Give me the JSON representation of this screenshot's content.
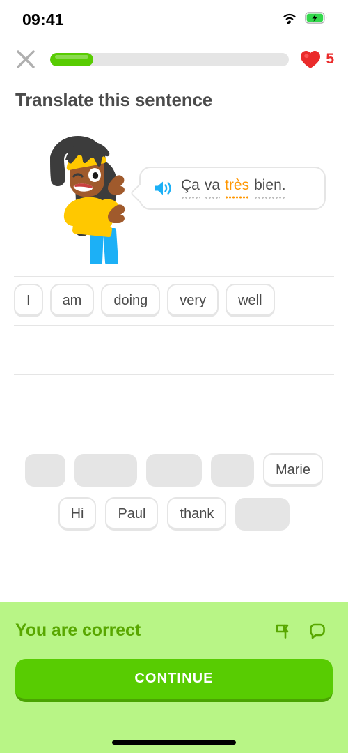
{
  "status_bar": {
    "time": "09:41",
    "wifi_icon": "wifi-icon",
    "battery_icon": "battery-charging-icon"
  },
  "top_bar": {
    "close_icon": "close-icon",
    "progress_percent": 18,
    "heart_icon": "heart-icon",
    "hearts_count": "5"
  },
  "prompt": {
    "title": "Translate this sentence"
  },
  "challenge": {
    "character_alt": "character-illustration",
    "speaker_icon": "speaker-icon",
    "sentence_tokens": [
      {
        "text": "Ça",
        "highlight": false
      },
      {
        "text": "va",
        "highlight": false
      },
      {
        "text": "très",
        "highlight": true
      },
      {
        "text": "bien.",
        "highlight": false
      }
    ]
  },
  "answer": {
    "line1": [
      "I",
      "am",
      "doing",
      "very",
      "well"
    ],
    "line2": []
  },
  "word_bank": {
    "row1": [
      {
        "label": "",
        "used": true
      },
      {
        "label": "",
        "used": true
      },
      {
        "label": "",
        "used": true
      },
      {
        "label": "",
        "used": true
      },
      {
        "label": "Marie",
        "used": false
      }
    ],
    "row2": [
      {
        "label": "Hi",
        "used": false
      },
      {
        "label": "Paul",
        "used": false
      },
      {
        "label": "thank",
        "used": false
      },
      {
        "label": "",
        "used": true
      }
    ]
  },
  "feedback": {
    "title": "You are correct",
    "report_icon": "flag-icon",
    "discuss_icon": "speech-bubble-icon",
    "continue_label": "CONTINUE"
  },
  "colors": {
    "brand_green": "#58cc02",
    "feedback_bg": "#b8f586",
    "feedback_text": "#58a700",
    "heart_red": "#ea2b2b",
    "highlight_orange": "#ff9600",
    "speaker_blue": "#1cb0f6",
    "text_gray": "#4b4b4b",
    "border_gray": "#e5e5e5"
  }
}
